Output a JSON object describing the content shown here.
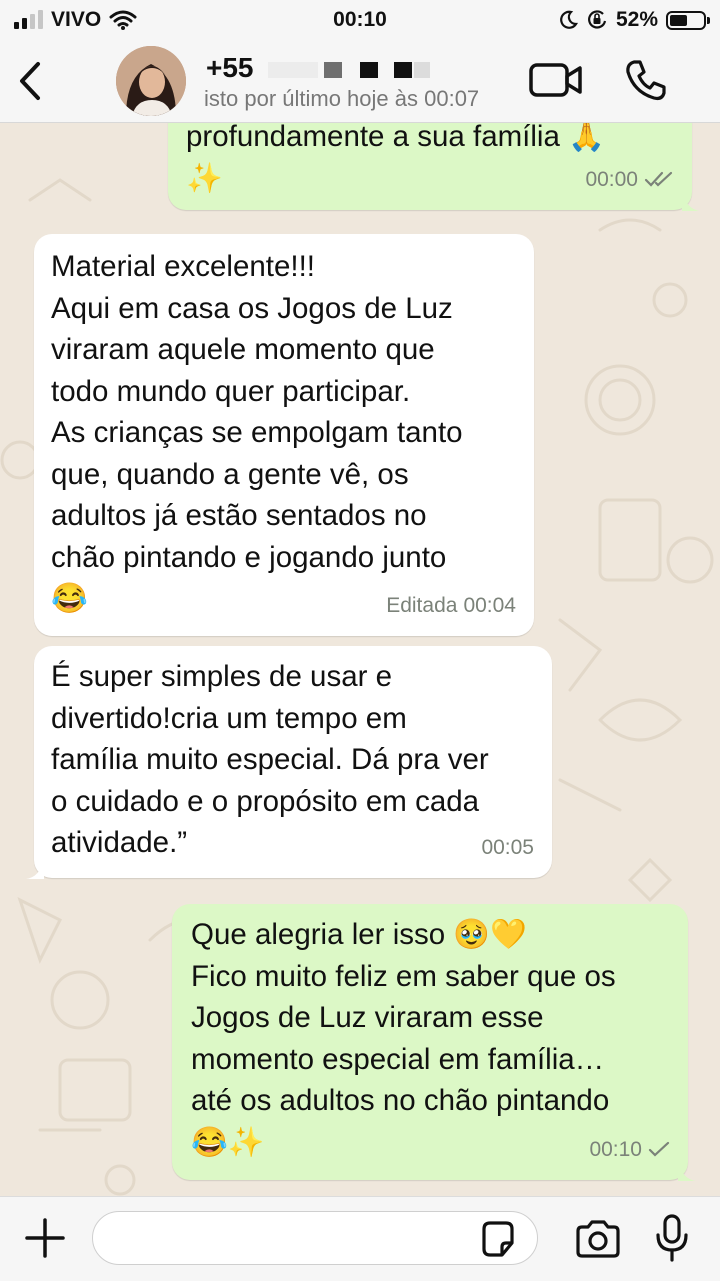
{
  "status_bar": {
    "carrier": "VIVO",
    "time": "00:10",
    "battery_text": "52%",
    "battery_level": 0.52,
    "signal_bars_active": 2,
    "signal_bars_total": 4
  },
  "header": {
    "contact_name": "+55",
    "contact_status": "isto por último hoje às 00:07"
  },
  "messages": [
    {
      "direction": "out",
      "text": "profundamente a sua família 🙏\n✨",
      "time": "00:00",
      "status": "read"
    },
    {
      "direction": "in",
      "text": "Material excelente!!!\nAqui em casa os Jogos de Luz\nviraram aquele momento que\ntodo mundo quer participar.\nAs crianças se empolgam tanto\nque, quando a gente vê, os\nadultos já estão sentados no\nchão pintando e jogando junto\n😂",
      "edited_label": "Editada",
      "time": "00:04"
    },
    {
      "direction": "in",
      "text": "É super simples de usar e\ndivertido!cria um tempo em\nfamília muito especial. Dá pra ver\no cuidado e o propósito em cada\natividade.”",
      "time": "00:05"
    },
    {
      "direction": "out",
      "text": "Que alegria ler isso 🥹💛\nFico muito feliz em saber que os\nJogos de Luz viraram esse\nmomento especial em família…\naté os adultos no chão pintando\n😂✨",
      "time": "00:10",
      "status": "sent"
    }
  ],
  "composer": {
    "placeholder": ""
  },
  "colors": {
    "outgoing_bubble": "#dcf8c6",
    "incoming_bubble": "#ffffff",
    "wallpaper": "#efe7dc",
    "bar_background": "#f6f6f6"
  },
  "icons": {
    "back": "chevron-left-icon",
    "video": "video-camera-icon",
    "call": "phone-icon",
    "plus": "plus-icon",
    "sticker": "sticker-icon",
    "camera": "camera-icon",
    "mic": "microphone-icon"
  }
}
